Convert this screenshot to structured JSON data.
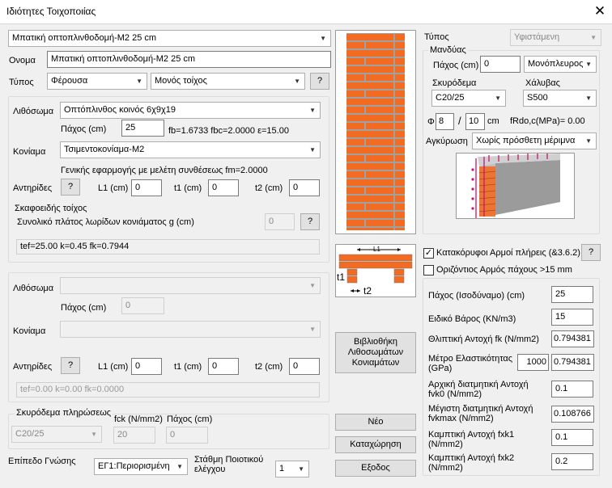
{
  "window": {
    "title": "Ιδιότητες Τοιχοποιίας",
    "close": "✕"
  },
  "top": {
    "preset": "Μπατική οπτοπλινθοδομή-Μ2 25 cm",
    "name_label": "Ονομα",
    "name": "Μπατική οπτοπλινθοδομή-Μ2 25 cm",
    "type_label": "Τύπος",
    "type": "Φέρουσα",
    "wall": "Μονός τοίχος",
    "help": "?"
  },
  "g1": {
    "unit_label": "Λιθόσωμα",
    "unit": "Οπτόπλινθος κοινός 6χ9χ19",
    "thick_label": "Πάχος (cm)",
    "thick": "25",
    "props": "fb=1.6733 fbc=2.0000 ε=15.00",
    "mortar_label": "Κονίαμα",
    "mortar": "Τσιμεντοκονίαμα-Μ2",
    "mortar_note": "Γενικής εφαρμογής με μελέτη συνθέσεως fm=2.0000",
    "ant_label": "Αντηρίδες",
    "help": "?",
    "l1_label": "L1 (cm)",
    "l1": "0",
    "t1_label": "t1 (cm)",
    "t1": "0",
    "t2_label": "t2 (cm)",
    "t2": "0",
    "skaf_label": "Σκαφοειδής τοίχος",
    "skaf_text": "Συνολικό πλάτος λωρίδων κονιάματος g (cm)",
    "skaf_value": "0",
    "result": "tef=25.00 k=0.45 fk=0.7944"
  },
  "g2": {
    "unit_label": "Λιθόσωμα",
    "thick_label": "Πάχος (cm)",
    "thick": "0",
    "mortar_label": "Κονίαμα",
    "ant_label": "Αντηρίδες",
    "help": "?",
    "l1_label": "L1 (cm)",
    "l1": "0",
    "t1_label": "t1 (cm)",
    "t1": "0",
    "t2_label": "t2 (cm)",
    "t2": "0",
    "result": "tef=0.00 k=0.00 fk=0.0000"
  },
  "fill": {
    "label": "Σκυρόδεμα πληρώσεως",
    "fck_label": "fck (N/mm2)",
    "thick_label": "Πάχος (cm)",
    "concrete": "C20/25",
    "fck": "20",
    "thick": "0"
  },
  "bottom": {
    "know_label": "Επίπεδο Γνώσης",
    "know": "ΕΓ1:Περιορισμένη",
    "qc_label": "Στάθμη Ποιοτικού ελέγχου",
    "qc": "1"
  },
  "buttons": {
    "library": "Βιβλιοθήκη Λιθοσωμάτων Κονιαμάτων",
    "new": "Νέο",
    "save": "Καταχώρηση",
    "exit": "Εξοδος"
  },
  "diagram": {
    "l1": "L1",
    "t1": "t1",
    "t2": "t2"
  },
  "right": {
    "type_label": "Τύπος",
    "type": "Υφιστάμενη",
    "mandyas": "Μανδύας",
    "thick_label": "Πάχος (cm)",
    "thick": "0",
    "side": "Μονόπλευρος",
    "concrete_label": "Σκυρόδεμα",
    "concrete": "C20/25",
    "steel_label": "Χάλυβας",
    "steel": "S500",
    "phi_label": "Φ",
    "phi": "8",
    "slash": "/",
    "spacing": "10",
    "cm": "cm",
    "frdo": "fRdo,c(MPa)= 0.00",
    "anchor_label": "Αγκύρωση",
    "anchor": "Χωρίς πρόσθετη μέριμνα"
  },
  "checks": {
    "vertical": "Κατακόρυφοι Αρμοί πλήρεις (&3.6.2)",
    "vertical_checked": true,
    "help": "?",
    "horizontal": "Οριζόντιος Αρμός πάχους >15 mm",
    "horizontal_checked": false
  },
  "props": {
    "thick_label": "Πάχος (Ισοδύναμο) (cm)",
    "thick": "25",
    "weight_label": "Ειδικό Βάρος (KN/m3)",
    "weight": "15",
    "fk_label": "Θλιπτική Αντοχή fk (N/mm2)",
    "fk": "0.794381",
    "e_label": "Μέτρο Ελαστικότητας (GPa)",
    "e1": "1000",
    "e2": "0.794381",
    "fvk0_label": "Αρχική διατμητική Αντοχή fvk0 (N/mm2)",
    "fvk0": "0.1",
    "fvkmax_label": "Μέγιστη διατμητική Αντοχή fvkmax (N/mm2)",
    "fvkmax": "0.108766",
    "fxk1_label": "Καμπτική Αντοχή fxk1 (N/mm2)",
    "fxk1": "0.1",
    "fxk2_label": "Καμπτική Αντοχή fxk2 (N/mm2)",
    "fxk2": "0.2"
  }
}
